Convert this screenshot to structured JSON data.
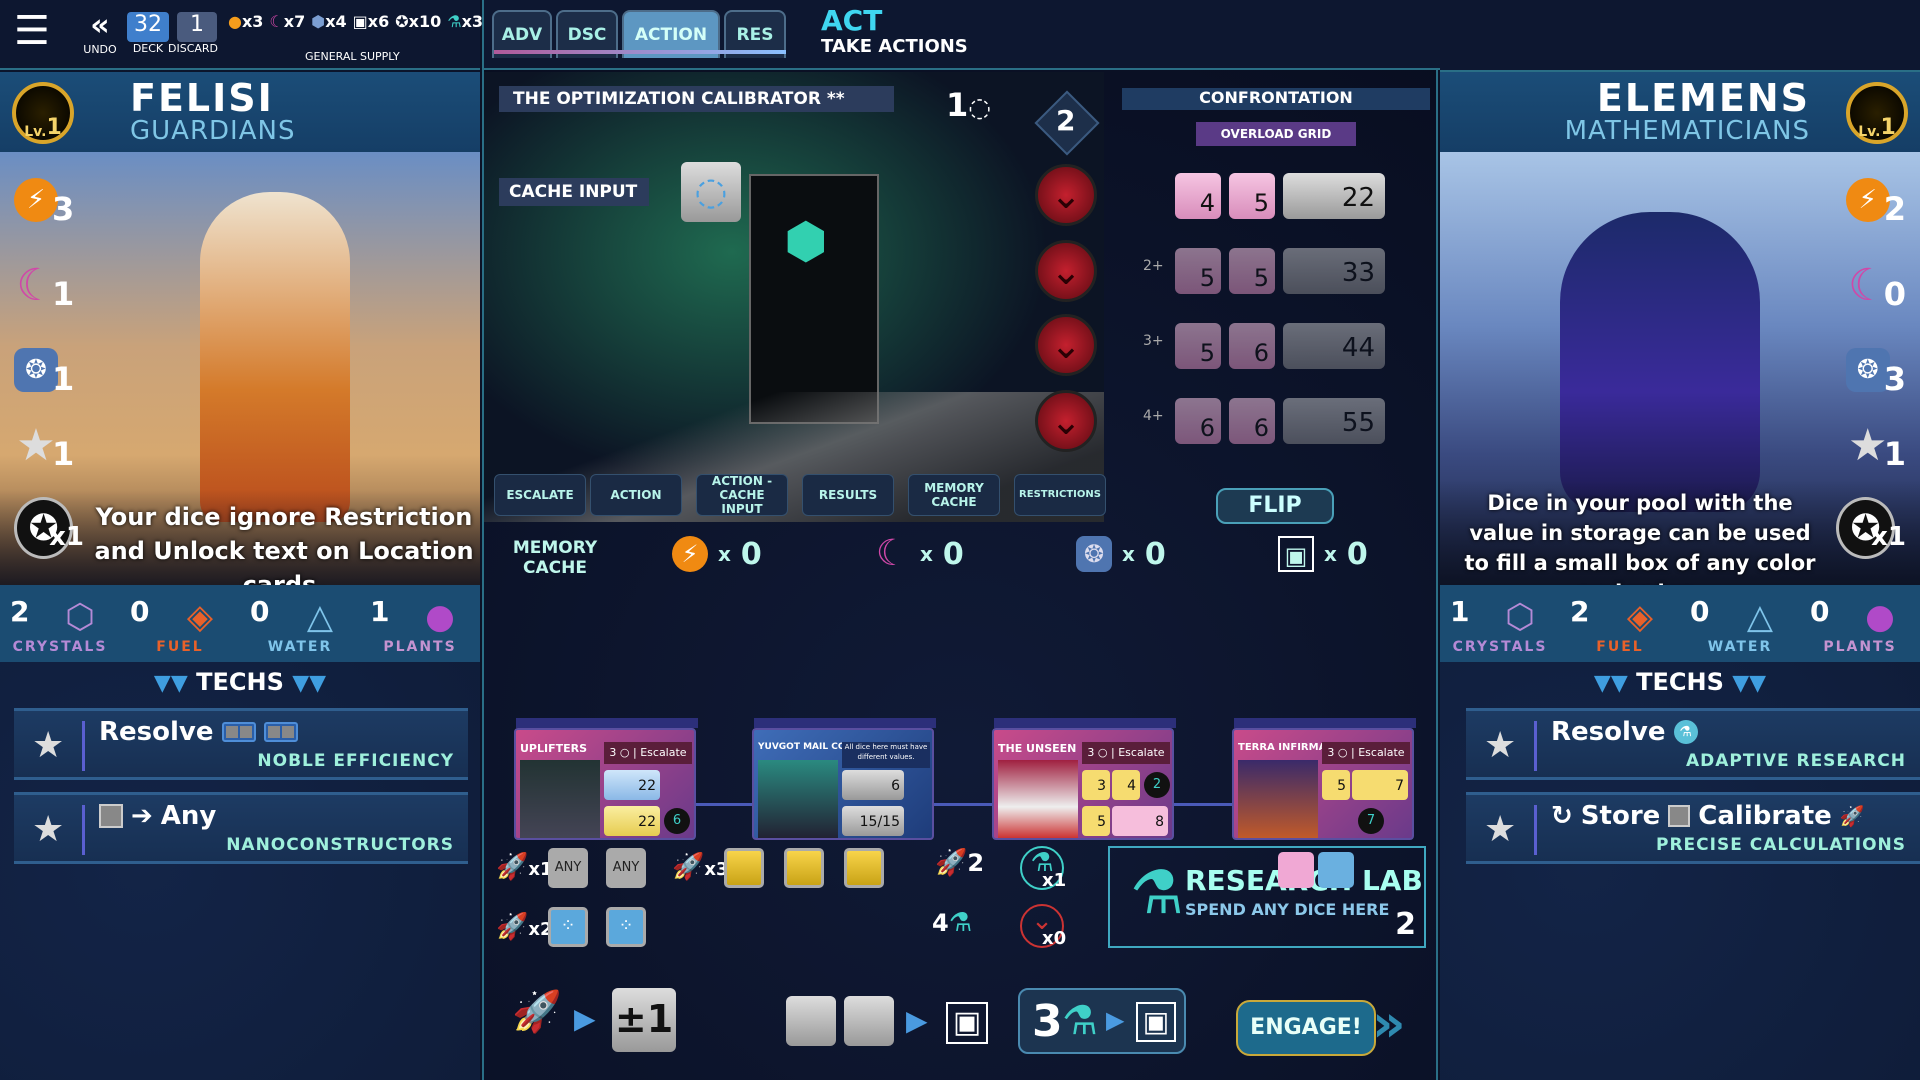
{
  "topbar": {
    "undo": "UNDO",
    "deck_count": "32",
    "deck": "DECK",
    "discard_count": "1",
    "discard": "DISCARD",
    "general_supply": "GENERAL SUPPLY",
    "supply": [
      {
        "icon": "energy-icon",
        "count": "x3"
      },
      {
        "icon": "moon-icon",
        "count": "x7"
      },
      {
        "icon": "shield-icon",
        "count": "x4"
      },
      {
        "icon": "memory-icon",
        "count": "x6"
      },
      {
        "icon": "star-token-icon",
        "count": "x10"
      },
      {
        "icon": "research-icon",
        "count": "x3"
      }
    ]
  },
  "phases": {
    "tabs": [
      "ADV",
      "DSC",
      "ACTION",
      "RES"
    ],
    "active": "ACTION",
    "phase": "ACT",
    "phase_desc": "TAKE ACTIONS"
  },
  "left_player": {
    "name": "FELISI",
    "faction": "GUARDIANS",
    "level": "1",
    "level_label": "Lv.",
    "stats": [
      "3",
      "1",
      "1",
      "1",
      "x1"
    ],
    "ability": "Your dice ignore Restriction and Unlock text on Location cards.",
    "resources": [
      {
        "name": "CRYSTALS",
        "value": "2",
        "color": "#b58ad6"
      },
      {
        "name": "FUEL",
        "value": "0",
        "color": "#e8612a"
      },
      {
        "name": "WATER",
        "value": "0",
        "color": "#7fc4ea"
      },
      {
        "name": "PLANTS",
        "value": "1",
        "color": "#c493d0"
      }
    ],
    "techs_title": "TECHS",
    "techs": [
      {
        "action": "Resolve",
        "name": "NOBLE EFFICIENCY"
      },
      {
        "action": "Any",
        "name": "NANOCONSTRUCTORS"
      }
    ]
  },
  "right_player": {
    "name": "ELEMENS",
    "faction": "MATHEMATICIANS",
    "level": "1",
    "level_label": "Lv.",
    "stats": [
      "2",
      "0",
      "3",
      "1",
      "x1"
    ],
    "ability": "Dice in your pool with the value in storage can be used to fill a small box of any color and value.",
    "resources": [
      {
        "name": "CRYSTALS",
        "value": "1",
        "color": "#b58ad6"
      },
      {
        "name": "FUEL",
        "value": "2",
        "color": "#e8612a"
      },
      {
        "name": "WATER",
        "value": "0",
        "color": "#7fc4ea"
      },
      {
        "name": "PLANTS",
        "value": "0",
        "color": "#c493d0"
      }
    ],
    "techs_title": "TECHS",
    "techs": [
      {
        "action": "Resolve",
        "name": "ADAPTIVE RESEARCH"
      },
      {
        "action": "Store",
        "action2": "Calibrate",
        "name": "PRECISE CALCULATIONS"
      }
    ]
  },
  "location": {
    "title": "THE OPTIMIZATION CALIBRATOR **",
    "counter": "1",
    "diamond": "2",
    "cache_input": "CACHE INPUT",
    "tabs": [
      "ESCALATE",
      "ACTION",
      "ACTION - CACHE INPUT",
      "RESULTS",
      "MEMORY CACHE",
      "RESTRICTIONS"
    ]
  },
  "confrontation": {
    "title": "CONFRONTATION",
    "subtitle": "OVERLOAD GRID",
    "flip": "FLIP",
    "rows": [
      {
        "dice": [
          "4",
          "5"
        ],
        "total": "22",
        "threshold": ""
      },
      {
        "dice": [
          "5",
          "5"
        ],
        "total": "33",
        "threshold": "2+"
      },
      {
        "dice": [
          "5",
          "6"
        ],
        "total": "44",
        "threshold": "3+"
      },
      {
        "dice": [
          "6",
          "6"
        ],
        "total": "55",
        "threshold": "4+"
      }
    ]
  },
  "memory_cache": {
    "label": "MEMORY CACHE",
    "items": [
      {
        "icon": "energy-icon",
        "count": "0"
      },
      {
        "icon": "moon-icon",
        "count": "0"
      },
      {
        "icon": "shield-icon",
        "count": "0"
      },
      {
        "icon": "memory-icon",
        "count": "0"
      }
    ],
    "x": "x"
  },
  "cards": [
    {
      "name": "UPLIFTERS",
      "cost": "3 ○ | Escalate",
      "slots": [
        "22",
        "22"
      ],
      "reward": "6"
    },
    {
      "name": "YUVGOT MAIL CO.",
      "note": "All dice here must have different values.",
      "slots": [
        "6",
        "15/15"
      ]
    },
    {
      "name": "THE UNSEEN",
      "cost": "3 ○ | Escalate",
      "slots": [
        "3",
        "4",
        "5",
        "8"
      ],
      "reward": "2"
    },
    {
      "name": "TERRA INFIRMA",
      "cost": "3 ○ | Escalate",
      "slots": [
        "5",
        "7"
      ],
      "reward": "7"
    }
  ],
  "pool": {
    "any": "ANY",
    "rocket_counts": [
      "x1",
      "x3",
      "x2"
    ],
    "rockets": "2",
    "flasks": "4",
    "research_tokens": "x1",
    "threat_tokens": "x0"
  },
  "research_lab": {
    "title": "RESEARCH LAB",
    "subtitle": "SPEND ANY DICE HERE",
    "value": "2"
  },
  "bottom": {
    "plus_minus": "±1",
    "flask_cost": "3",
    "engage": "ENGAGE!"
  }
}
